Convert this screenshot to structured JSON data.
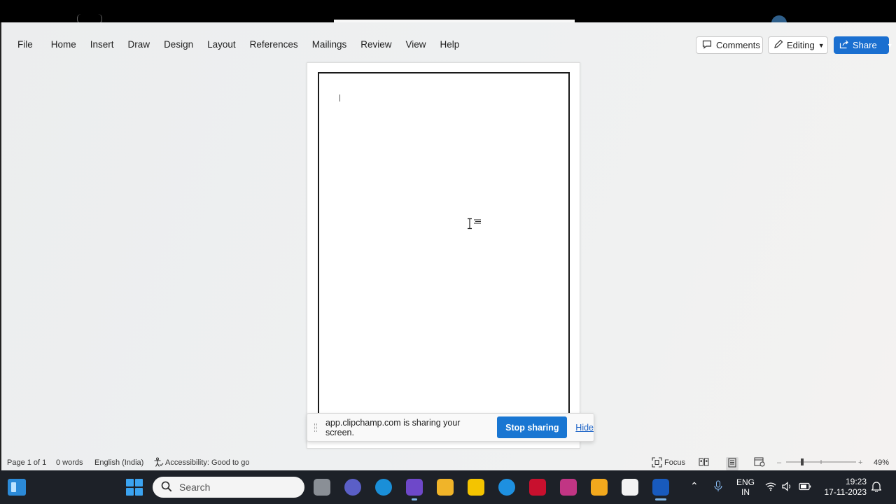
{
  "ribbon": {
    "tabs": [
      "File",
      "Home",
      "Insert",
      "Draw",
      "Design",
      "Layout",
      "References",
      "Mailings",
      "Review",
      "View",
      "Help"
    ],
    "comments_label": "Comments",
    "editing_label": "Editing",
    "share_label": "Share"
  },
  "sharing_bar": {
    "message": "app.clipchamp.com is sharing your screen.",
    "stop_label": "Stop sharing",
    "hide_label": "Hide"
  },
  "status": {
    "page": "Page 1 of 1",
    "words": "0 words",
    "language": "English (India)",
    "accessibility": "Accessibility: Good to go",
    "focus": "Focus",
    "zoom": "49%"
  },
  "taskbar": {
    "search_placeholder": "Search",
    "lang_line1": "ENG",
    "lang_line2": "IN",
    "time": "19:23",
    "date": "17-11-2023"
  },
  "colors": {
    "share_button": "#1a6fd0",
    "stop_sharing_button": "#1976d2",
    "taskbar": "#1d2128"
  },
  "icons": [
    "comment-icon",
    "pencil-icon",
    "share-icon",
    "accessibility-icon",
    "focus-icon",
    "read-mode-icon",
    "print-layout-icon",
    "web-layout-icon",
    "search-icon",
    "chevron-up-icon",
    "microphone-icon",
    "wifi-icon",
    "volume-icon",
    "battery-icon",
    "notification-icon"
  ]
}
